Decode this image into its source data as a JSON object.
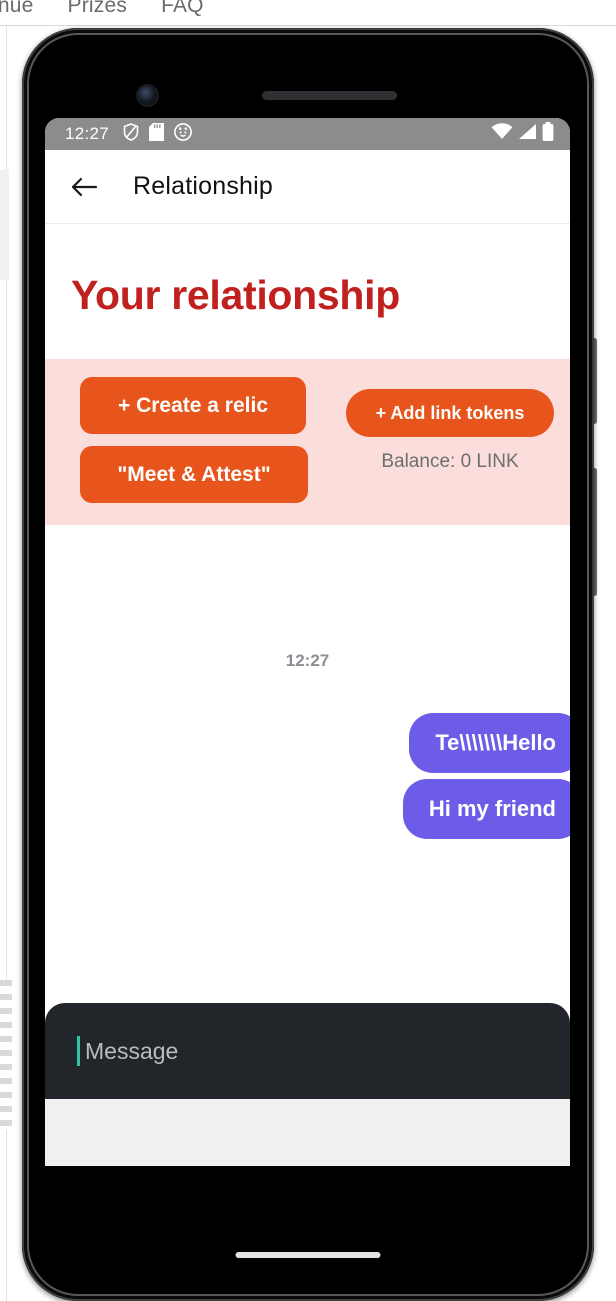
{
  "background_page": {
    "nav_items": [
      "enue",
      "Prizes",
      "FAQ"
    ]
  },
  "device": {
    "front_camera_icon": "camera-icon",
    "earpiece_icon": "speaker-grille-icon",
    "power_button": "power-button",
    "volume_button": "volume-button",
    "home_indicator": "home-indicator"
  },
  "status_bar": {
    "clock": "12:27",
    "left_icons": [
      "shield-icon",
      "sd-card-icon",
      "cat-face-icon"
    ],
    "right_icons": [
      "wifi-icon",
      "cell-signal-icon",
      "battery-full-icon"
    ]
  },
  "app_bar": {
    "back_icon": "back-arrow-icon",
    "title": "Relationship"
  },
  "main": {
    "heading": "Your relationship",
    "actions": {
      "create_relic_label": "+ Create a relic",
      "meet_attest_label": "\"Meet & Attest\"",
      "add_link_tokens_label": "+ Add link tokens",
      "balance_label": "Balance: 0 LINK"
    },
    "chat": {
      "timestamp": "12:27",
      "messages": [
        {
          "text": "Te\\\\\\\\\\\\\\Hello",
          "side": "outgoing"
        },
        {
          "text": "Hi my friend",
          "side": "outgoing"
        }
      ]
    },
    "composer": {
      "placeholder": "Message"
    }
  },
  "colors": {
    "heading_red": "#c0211f",
    "action_panel_pink": "#fbdedb",
    "button_orange": "#e8551c",
    "bubble_purple": "#6c5ce7",
    "composer_dark": "#22262b",
    "caret_teal": "#2ec4a6",
    "status_bar_gray": "#8c8c8c"
  }
}
